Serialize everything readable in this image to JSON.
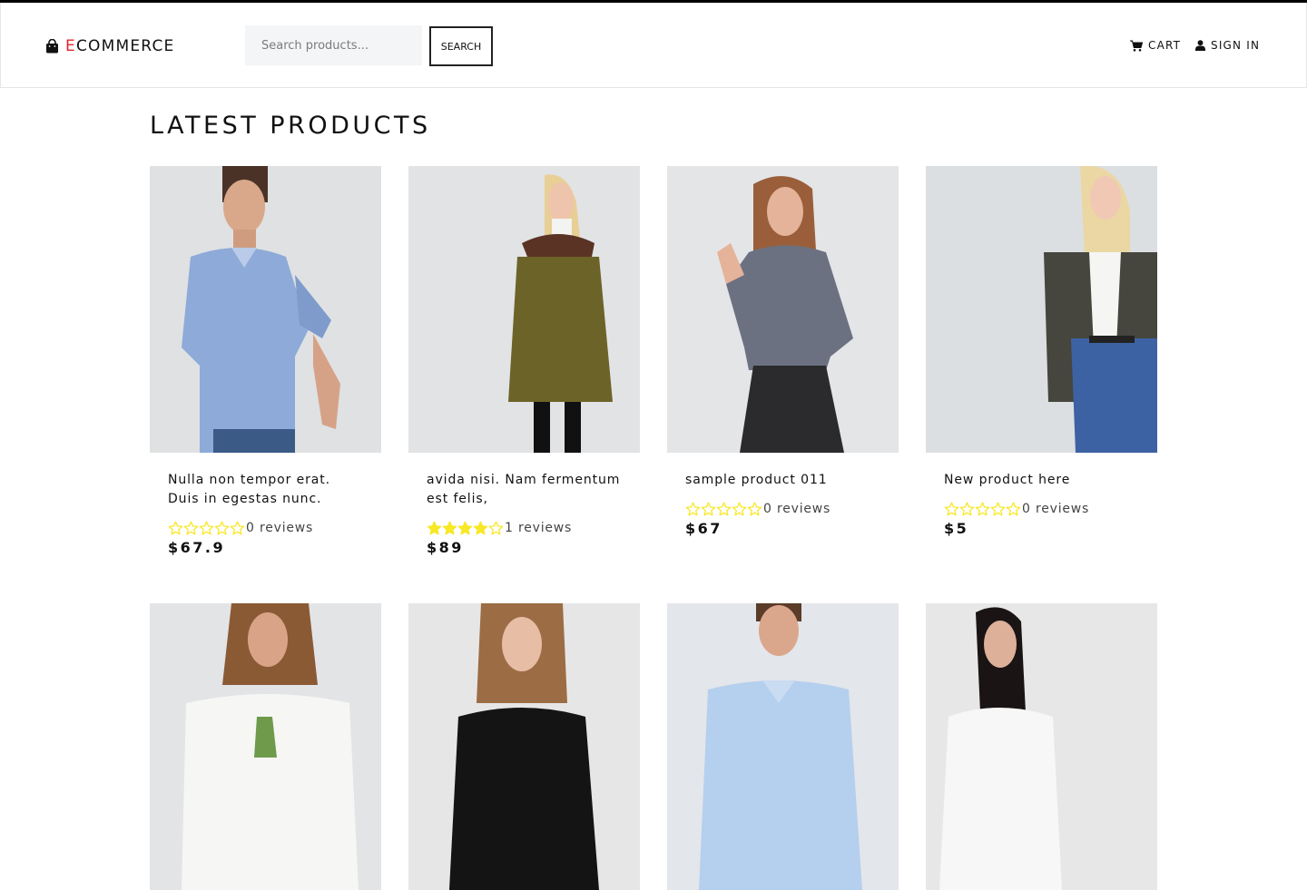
{
  "brand": {
    "first_letter": "E",
    "rest": "COMMERCE"
  },
  "search": {
    "placeholder": "Search products...",
    "button_label": "SEARCH"
  },
  "nav": {
    "cart_label": "CART",
    "signin_label": "SIGN IN"
  },
  "section_title": "LATEST PRODUCTS",
  "colors": {
    "accent": "#e4232c",
    "star": "#f8e825"
  },
  "products": [
    {
      "name": "Nulla non tempor erat. Duis in egestas nunc.",
      "rating": 0,
      "reviews_text": "0 reviews",
      "price": "$67.9"
    },
    {
      "name": "avida nisi. Nam fermentum est felis,",
      "rating": 4,
      "reviews_text": "1 reviews",
      "price": "$89"
    },
    {
      "name": "sample product 011",
      "rating": 0,
      "reviews_text": "0 reviews",
      "price": "$67"
    },
    {
      "name": "New product here",
      "rating": 0,
      "reviews_text": "0 reviews",
      "price": "$5"
    }
  ]
}
